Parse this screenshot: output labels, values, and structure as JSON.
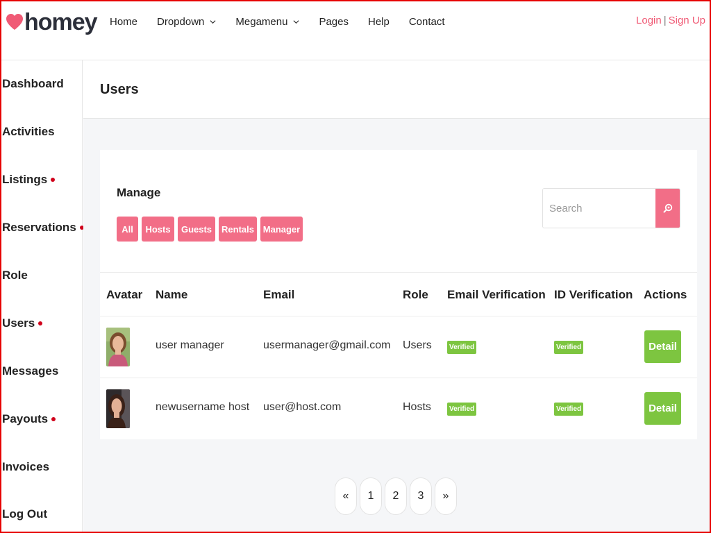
{
  "brand": {
    "name": "homey",
    "accent": "#f26e87",
    "success": "#7dc540"
  },
  "nav": {
    "items": [
      {
        "label": "Home",
        "has_dropdown": false
      },
      {
        "label": "Dropdown",
        "has_dropdown": true
      },
      {
        "label": "Megamenu",
        "has_dropdown": true
      },
      {
        "label": "Pages",
        "has_dropdown": false
      },
      {
        "label": "Help",
        "has_dropdown": false
      },
      {
        "label": "Contact",
        "has_dropdown": false
      }
    ],
    "login": "Login",
    "separator": "|",
    "signup": "Sign Up"
  },
  "sidebar": {
    "items": [
      {
        "label": "Dashboard",
        "dot": false
      },
      {
        "label": "Activities",
        "dot": false
      },
      {
        "label": "Listings",
        "dot": true
      },
      {
        "label": "Reservations",
        "dot": true
      },
      {
        "label": "Role",
        "dot": false
      },
      {
        "label": "Users",
        "dot": true
      },
      {
        "label": "Messages",
        "dot": false
      },
      {
        "label": "Payouts",
        "dot": true
      },
      {
        "label": "Invoices",
        "dot": false
      },
      {
        "label": "Log Out",
        "dot": false
      }
    ]
  },
  "page": {
    "title": "Users"
  },
  "manage": {
    "label": "Manage",
    "filters": [
      "All",
      "Hosts",
      "Guests",
      "Rentals",
      "Manager"
    ]
  },
  "search": {
    "placeholder": "Search",
    "icon": "search-icon"
  },
  "table": {
    "headers": [
      "Avatar",
      "Name",
      "Email",
      "Role",
      "Email Verification",
      "ID Verification",
      "Actions"
    ],
    "rows": [
      {
        "name": "user manager",
        "email": "usermanager@gmail.com",
        "role": "Users",
        "email_verification": "Verified",
        "id_verification": "Verified",
        "action": "Detail"
      },
      {
        "name": "newusername host",
        "email": "user@host.com",
        "role": "Hosts",
        "email_verification": "Verified",
        "id_verification": "Verified",
        "action": "Detail"
      }
    ]
  },
  "pagination": {
    "prev": "«",
    "pages": [
      "1",
      "2",
      "3"
    ],
    "next": "»"
  }
}
